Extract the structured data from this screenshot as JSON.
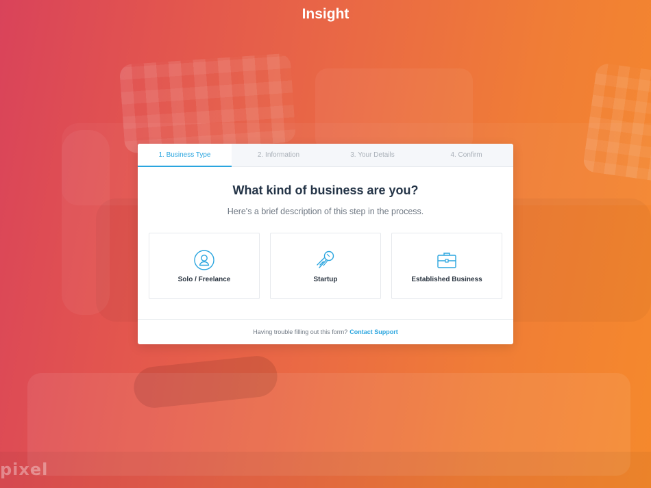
{
  "app": {
    "title": "Insight"
  },
  "watermark": "pixel",
  "steps": [
    {
      "label": "1. Business Type",
      "active": true
    },
    {
      "label": "2. Information",
      "active": false
    },
    {
      "label": "3. Your Details",
      "active": false
    },
    {
      "label": "4. Confirm",
      "active": false
    }
  ],
  "main": {
    "heading": "What kind of business are you?",
    "subheading": "Here's a brief description of this step in the process."
  },
  "options": [
    {
      "label": "Solo / Freelance",
      "icon": "person-icon"
    },
    {
      "label": "Startup",
      "icon": "rocket-icon"
    },
    {
      "label": "Established Business",
      "icon": "briefcase-icon"
    }
  ],
  "footer": {
    "text": "Having trouble filling out this form?",
    "link_label": "Contact Support"
  },
  "colors": {
    "accent": "#2aa5df",
    "gradient_start": "#d9435a",
    "gradient_end": "#f5892c"
  }
}
